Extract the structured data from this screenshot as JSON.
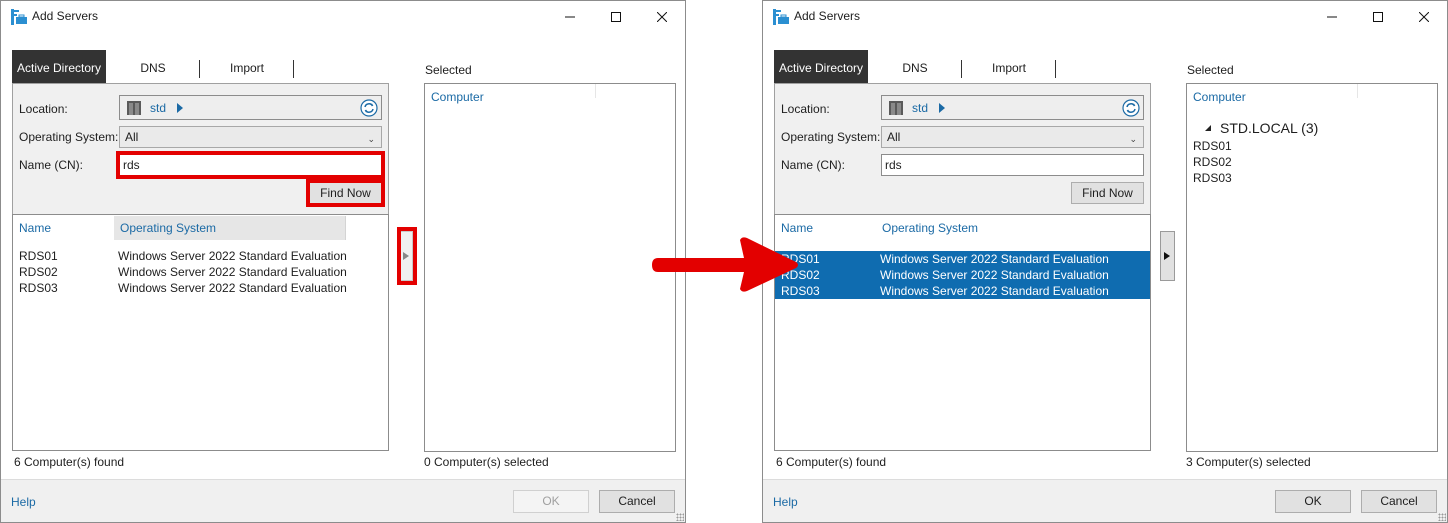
{
  "dialogs": [
    {
      "title": "Add Servers",
      "tabs": [
        "Active Directory",
        "DNS",
        "Import"
      ],
      "active_tab": "Active Directory",
      "location_label": "Location:",
      "location_value": "std",
      "os_label": "Operating System:",
      "os_value": "All",
      "name_label": "Name (CN):",
      "name_value": "rds",
      "find_now": "Find Now",
      "columns": [
        "Name",
        "Operating System"
      ],
      "results": [
        {
          "name": "RDS01",
          "os": "Windows Server 2022 Standard Evaluation"
        },
        {
          "name": "RDS02",
          "os": "Windows Server 2022 Standard Evaluation"
        },
        {
          "name": "RDS03",
          "os": "Windows Server 2022 Standard Evaluation"
        }
      ],
      "selected_label": "Selected",
      "selected_column": "Computer",
      "selected_group": "",
      "selected_items": [],
      "found_status": "6 Computer(s) found",
      "selected_status": "0 Computer(s) selected",
      "help": "Help",
      "ok": "OK",
      "cancel": "Cancel",
      "ok_enabled": false,
      "rows_selected": false,
      "highlights": [
        "name-input",
        "find-now-button",
        "add-to-selected-button"
      ]
    },
    {
      "title": "Add Servers",
      "tabs": [
        "Active Directory",
        "DNS",
        "Import"
      ],
      "active_tab": "Active Directory",
      "location_label": "Location:",
      "location_value": "std",
      "os_label": "Operating System:",
      "os_value": "All",
      "name_label": "Name (CN):",
      "name_value": "rds",
      "find_now": "Find Now",
      "columns": [
        "Name",
        "Operating System"
      ],
      "results": [
        {
          "name": "RDS01",
          "os": "Windows Server 2022 Standard Evaluation"
        },
        {
          "name": "RDS02",
          "os": "Windows Server 2022 Standard Evaluation"
        },
        {
          "name": "RDS03",
          "os": "Windows Server 2022 Standard Evaluation"
        }
      ],
      "selected_label": "Selected",
      "selected_column": "Computer",
      "selected_group": "STD.LOCAL (3)",
      "selected_items": [
        "RDS01",
        "RDS02",
        "RDS03"
      ],
      "found_status": "6 Computer(s) found",
      "selected_status": "3 Computer(s) selected",
      "help": "Help",
      "ok": "OK",
      "cancel": "Cancel",
      "ok_enabled": true,
      "rows_selected": true,
      "highlights": []
    }
  ],
  "colors": {
    "accent_blue": "#1b6aa5",
    "selection_blue": "#0f6cb0",
    "annotation_red": "#e30000",
    "active_tab_bg": "#333333"
  },
  "icons": {
    "app": "server-manager-icon",
    "location": "domain-icon",
    "refresh": "refresh-icon",
    "annotation": "red-arrow-icon"
  }
}
